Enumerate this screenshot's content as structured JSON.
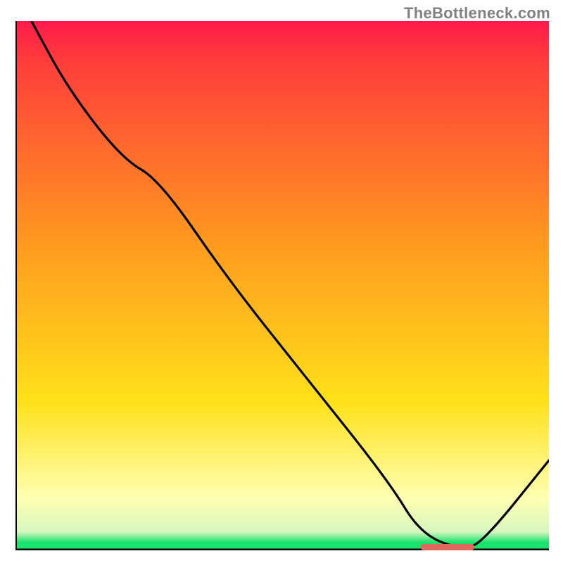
{
  "domain": "Chart",
  "watermark": "TheBottleneck.com",
  "colors": {
    "top": "#ff1a4b",
    "red": "#ff3b3b",
    "orange": "#ff9a1f",
    "yellow": "#ffe11a",
    "pale_yellow": "#ffffb0",
    "green": "#19e36c",
    "curve": "#000000",
    "marker": "#e0675c",
    "axis": "#000000"
  },
  "chart_data": {
    "type": "line",
    "title": "",
    "xlabel": "",
    "ylabel": "",
    "xlim": [
      0,
      100
    ],
    "ylim": [
      0,
      100
    ],
    "x": [
      3,
      10,
      20,
      27,
      40,
      55,
      70,
      76,
      84,
      88,
      100
    ],
    "values": [
      100,
      87,
      74,
      70,
      51,
      32,
      13,
      3,
      0,
      2,
      17
    ],
    "optimum_range_x": [
      76,
      86
    ],
    "optimum_y": 0,
    "note": "Values read from the plotted black curve as percentage of vertical extent; black line starts at top-left, descends with a slight knee around x≈27, reaches zero near x≈80±4, then rises toward the right edge."
  }
}
